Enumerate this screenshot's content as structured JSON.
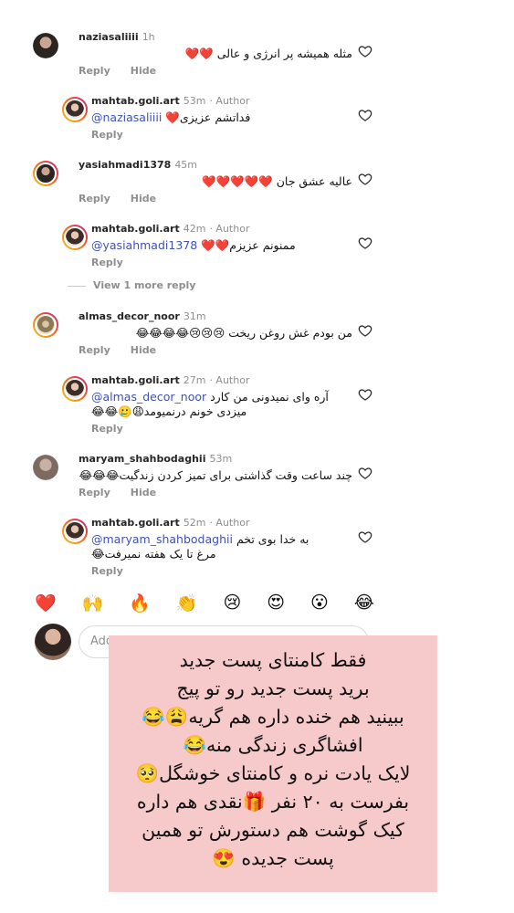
{
  "comments": [
    {
      "username": "naziasaliiii",
      "time": "1h",
      "author_tag": "",
      "mention": "",
      "text": "مثله همیشه پر انرژی و عالی ❤️❤️",
      "reply_label": "Reply",
      "hide_label": "Hide"
    },
    {
      "username": "mahtab.goli.art",
      "time": "53m",
      "author_tag": "· Author",
      "mention": "@naziasaliiii",
      "text": "فداتشم عزیزی❤️",
      "reply_label": "Reply",
      "hide_label": ""
    },
    {
      "username": "yasiahmadi1378",
      "time": "45m",
      "author_tag": "",
      "mention": "",
      "text": "عالیه عشق جان ❤️❤️❤️❤️❤️",
      "reply_label": "Reply",
      "hide_label": "Hide"
    },
    {
      "username": "mahtab.goli.art",
      "time": "42m",
      "author_tag": "· Author",
      "mention": "@yasiahmadi1378",
      "text": "ممنونم عزیزم❤️❤️",
      "reply_label": "Reply",
      "hide_label": ""
    },
    {
      "username": "almas_decor_noor",
      "time": "31m",
      "author_tag": "",
      "mention": "",
      "text": "من بودم غش روغن ریخت 😢😢😢😂😂😂😂",
      "reply_label": "Reply",
      "hide_label": "Hide"
    },
    {
      "username": "mahtab.goli.art",
      "time": "27m",
      "author_tag": "· Author",
      "mention": "@almas_decor_noor",
      "text": "آره وای نمیدونی من کارد میزدی خونم درنمیومد😩🥲😂😂",
      "reply_label": "Reply",
      "hide_label": ""
    },
    {
      "username": "maryam_shahbodaghii",
      "time": "53m",
      "author_tag": "",
      "mention": "",
      "text": "چند ساعت وقت گذاشتی برای تمیز کردن زندگیت😂😂😂",
      "reply_label": "Reply",
      "hide_label": "Hide"
    },
    {
      "username": "mahtab.goli.art",
      "time": "52m",
      "author_tag": "· Author",
      "mention": "@maryam_shahbodaghii",
      "text": "به خدا بوی تخم مرغ تا یک هفته نمیرفت😂",
      "reply_label": "Reply",
      "hide_label": ""
    }
  ],
  "view_more": "View 1 more reply",
  "reactions": [
    "❤️",
    "🙌",
    "🔥",
    "👏",
    "😢",
    "😍",
    "😮",
    "😂"
  ],
  "composer": {
    "placeholder": "Add"
  },
  "overlay_lines": [
    "فقط کامنتای پست جدید",
    "برید پست جدید رو تو پیج",
    "ببینید هم خنده داره هم گریه😩😂",
    "افشاگری زندگی منه😂",
    "لایک یادت نره و کامنتای خوشگل🥺",
    "بفرست به ۲۰ نفر 🎁نقدی هم داره",
    "کیک گوشت هم دستورش تو همین",
    "پست جدیده 😍"
  ],
  "colors": {
    "mention": "#3f51b5",
    "overlay_bg": "#f6c9cb",
    "heart": "#ed1c24"
  }
}
